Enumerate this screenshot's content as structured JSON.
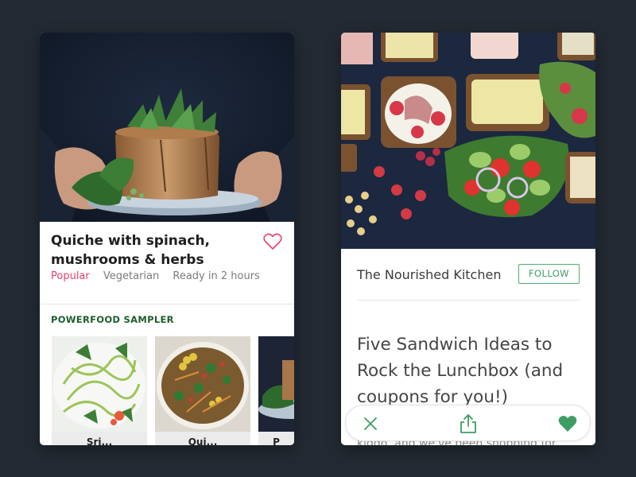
{
  "recipe_card": {
    "title": "Quiche with spinach, mushrooms & herbs",
    "tags": [
      "Popular",
      "Vegetarian",
      "Ready in 2 hours"
    ],
    "section_title": "POWERFOOD SAMPLER",
    "sampler": [
      {
        "label": "Sri..."
      },
      {
        "label": "Qui..."
      },
      {
        "label": "P"
      }
    ],
    "icons": {
      "favorite": "heart-outline-icon"
    },
    "colors": {
      "accent_pink": "#e8426b",
      "section_green": "#1e5c2c"
    }
  },
  "article_card": {
    "author": "The Nourished Kitchen",
    "follow_label": "FOLLOW",
    "title": "Five Sandwich Ideas to Rock the Lunchbox (and coupons for you!)",
    "snippet": "kiddo, and we've been shopping for",
    "actions": [
      "close-icon",
      "share-icon",
      "heart-filled-icon"
    ],
    "colors": {
      "accent_green": "#3e9d62"
    }
  }
}
